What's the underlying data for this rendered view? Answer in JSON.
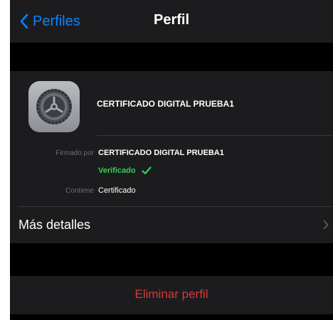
{
  "nav": {
    "back_label": "Perfiles",
    "title": "Perfil"
  },
  "profile": {
    "icon": "settings-gear-icon",
    "name": "CERTIFICADO DIGITAL PRUEBA1"
  },
  "details": {
    "signed_by_label": "Firmado por",
    "signed_by_value": "CERTIFICADO DIGITAL PRUEBA1",
    "verified_label": "Verificado",
    "contains_label": "Contiene",
    "contains_value": "Certificado"
  },
  "more_details": {
    "label": "Más detalles"
  },
  "actions": {
    "delete_label": "Eliminar perfil"
  },
  "colors": {
    "accent": "#0a84ff",
    "verified": "#30d158",
    "destructive": "#d33a36",
    "background": "#000000",
    "group_background": "#1c1c1e"
  }
}
